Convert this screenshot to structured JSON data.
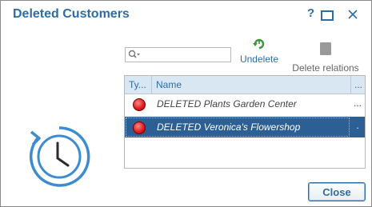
{
  "window": {
    "title": "Deleted Customers",
    "help_label": "?"
  },
  "search": {
    "value": "",
    "placeholder": ""
  },
  "toolbar": {
    "undelete_label": "Undelete",
    "delete_relations_label": "Delete relations"
  },
  "grid": {
    "columns": {
      "type": "Ty...",
      "name": "Name",
      "more": "..."
    },
    "rows": [
      {
        "name": "DELETED Plants Garden Center",
        "more": "...",
        "selected": false
      },
      {
        "name": "DELETED Veronica's Flowershop",
        "more": ".",
        "selected": true
      }
    ]
  },
  "buttons": {
    "close_label": "Close"
  },
  "colors": {
    "accent": "#2e6da4",
    "header_bg": "#d9e7f3",
    "selected_row": "#2c5f94",
    "status_deleted": "#e02020"
  }
}
